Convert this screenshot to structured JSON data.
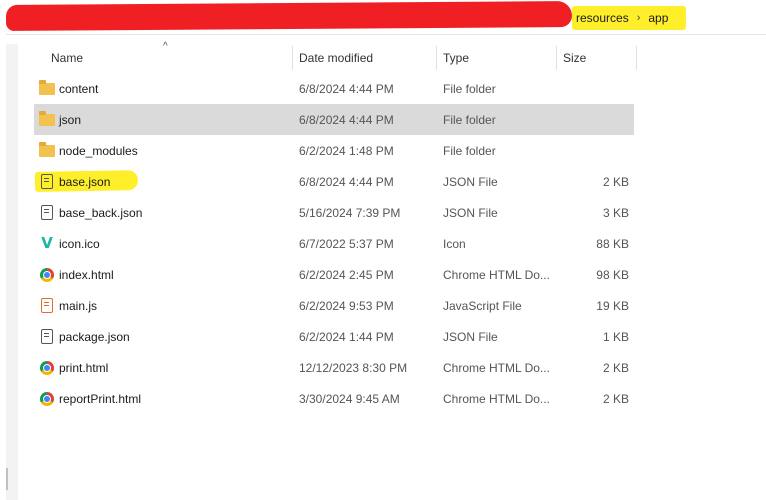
{
  "breadcrumb": {
    "items": [
      "resources",
      "app"
    ],
    "separator": "›"
  },
  "columns": {
    "name": "Name",
    "date_modified": "Date modified",
    "type": "Type",
    "size": "Size",
    "sort_indicator": "^"
  },
  "files": [
    {
      "name": "content",
      "date": "6/8/2024 4:44 PM",
      "type": "File folder",
      "size": "",
      "icon": "folder-icon"
    },
    {
      "name": "json",
      "date": "6/8/2024 4:44 PM",
      "type": "File folder",
      "size": "",
      "icon": "folder-icon"
    },
    {
      "name": "node_modules",
      "date": "6/2/2024 1:48 PM",
      "type": "File folder",
      "size": "",
      "icon": "folder-icon"
    },
    {
      "name": "base.json",
      "date": "6/8/2024 4:44 PM",
      "type": "JSON File",
      "size": "2 KB",
      "icon": "json-file-icon"
    },
    {
      "name": "base_back.json",
      "date": "5/16/2024 7:39 PM",
      "type": "JSON File",
      "size": "3 KB",
      "icon": "json-file-icon"
    },
    {
      "name": "icon.ico",
      "date": "6/7/2022 5:37 PM",
      "type": "Icon",
      "size": "88 KB",
      "icon": "ico-file-icon"
    },
    {
      "name": "index.html",
      "date": "6/2/2024 2:45 PM",
      "type": "Chrome HTML Do...",
      "size": "98 KB",
      "icon": "chrome-icon"
    },
    {
      "name": "main.js",
      "date": "6/2/2024 9:53 PM",
      "type": "JavaScript File",
      "size": "19 KB",
      "icon": "js-file-icon"
    },
    {
      "name": "package.json",
      "date": "6/2/2024 1:44 PM",
      "type": "JSON File",
      "size": "1 KB",
      "icon": "json-file-icon"
    },
    {
      "name": "print.html",
      "date": "12/12/2023 8:30 PM",
      "type": "Chrome HTML Do...",
      "size": "2 KB",
      "icon": "chrome-icon"
    },
    {
      "name": "reportPrint.html",
      "date": "3/30/2024 9:45 AM",
      "type": "Chrome HTML Do...",
      "size": "2 KB",
      "icon": "chrome-icon"
    }
  ],
  "selected_file": "json",
  "highlighted_file": "base.json",
  "colors": {
    "redaction": "#ef1f24",
    "highlight": "#ffee2a",
    "selection": "#dadada",
    "folder": "#f2c14e"
  }
}
